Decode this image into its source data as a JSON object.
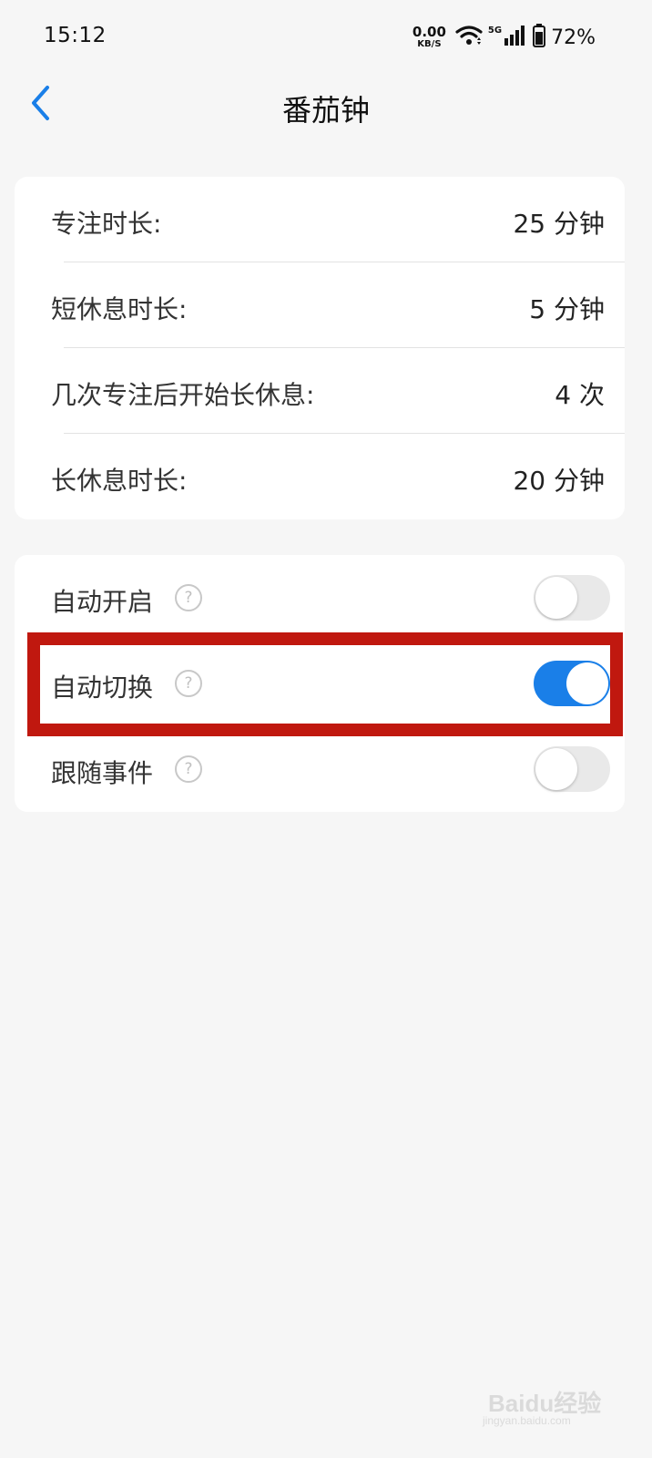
{
  "status_bar": {
    "time": "15:12",
    "net_speed_value": "0.00",
    "net_speed_unit": "KB/S",
    "signal_label": "5G",
    "battery_percent": "72%",
    "icons": [
      "wifi-icon",
      "signal-icon",
      "battery-icon"
    ]
  },
  "header": {
    "title": "番茄钟",
    "back_icon": "chevron-left-icon"
  },
  "durations": [
    {
      "label": "专注时长:",
      "value": "25 分钟"
    },
    {
      "label": "短休息时长:",
      "value": "5 分钟"
    },
    {
      "label": "几次专注后开始长休息:",
      "value": "4 次"
    },
    {
      "label": "长休息时长:",
      "value": "20 分钟"
    }
  ],
  "toggles": [
    {
      "label": "自动开启",
      "help": "?",
      "enabled": false
    },
    {
      "label": "自动切换",
      "help": "?",
      "enabled": true
    },
    {
      "label": "跟随事件",
      "help": "?",
      "enabled": false
    }
  ],
  "colors": {
    "accent": "#1a7fe8",
    "highlight": "#c0180f",
    "background": "#f6f6f6"
  },
  "watermark": {
    "brand": "Baidu经验",
    "url": "jingyan.baidu.com"
  }
}
